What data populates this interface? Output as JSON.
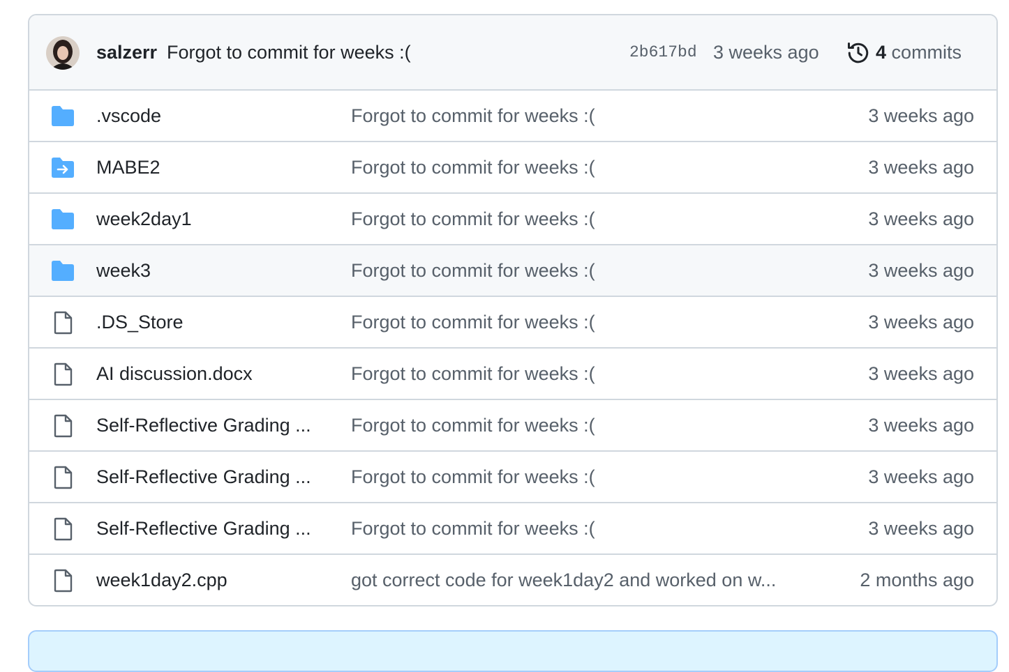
{
  "latest_commit": {
    "author": "salzerr",
    "message": "Forgot to commit for weeks :(",
    "sha": "2b617bd",
    "time": "3 weeks ago",
    "commit_count": "4",
    "commit_label": "commits"
  },
  "files": [
    {
      "name": ".vscode",
      "type": "folder",
      "icon": "folder-icon",
      "message": "Forgot to commit for weeks :(",
      "time": "3 weeks ago"
    },
    {
      "name": "MABE2",
      "type": "submodule",
      "icon": "submodule-folder-icon",
      "message": "Forgot to commit for weeks :(",
      "time": "3 weeks ago"
    },
    {
      "name": "week2day1",
      "type": "folder",
      "icon": "folder-icon",
      "message": "Forgot to commit for weeks :(",
      "time": "3 weeks ago"
    },
    {
      "name": "week3",
      "type": "folder",
      "icon": "folder-icon",
      "message": "Forgot to commit for weeks :(",
      "time": "3 weeks ago"
    },
    {
      "name": ".DS_Store",
      "type": "file",
      "icon": "file-icon",
      "message": "Forgot to commit for weeks :(",
      "time": "3 weeks ago"
    },
    {
      "name": "AI discussion.docx",
      "type": "file",
      "icon": "file-icon",
      "message": "Forgot to commit for weeks :(",
      "time": "3 weeks ago"
    },
    {
      "name": "Self-Reflective Grading ...",
      "type": "file",
      "icon": "file-icon",
      "message": "Forgot to commit for weeks :(",
      "time": "3 weeks ago"
    },
    {
      "name": "Self-Reflective Grading ...",
      "type": "file",
      "icon": "file-icon",
      "message": "Forgot to commit for weeks :(",
      "time": "3 weeks ago"
    },
    {
      "name": "Self-Reflective Grading ...",
      "type": "file",
      "icon": "file-icon",
      "message": "Forgot to commit for weeks :(",
      "time": "3 weeks ago"
    },
    {
      "name": "week1day2.cpp",
      "type": "file",
      "icon": "file-icon",
      "message": "got correct code for week1day2 and worked on w...",
      "time": "2 months ago"
    }
  ],
  "colors": {
    "folder": "#54aeff",
    "file": "#57606a",
    "border": "#d0d7de"
  }
}
